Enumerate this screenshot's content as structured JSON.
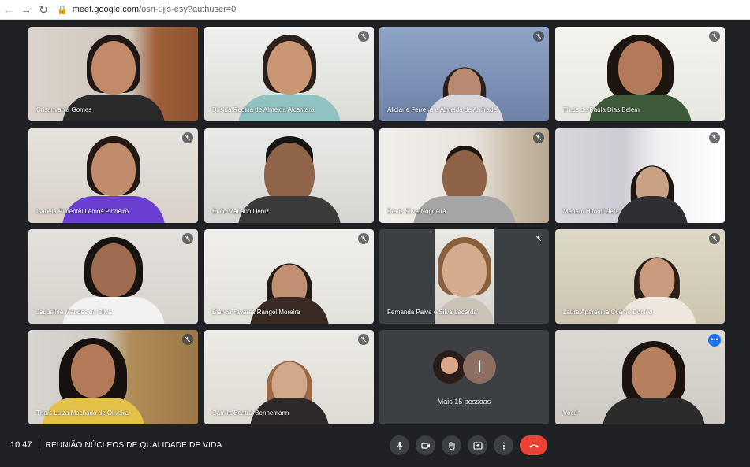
{
  "browser": {
    "url_host": "meet.google.com",
    "url_path": "/osn-ujjs-esy?authuser=0"
  },
  "participants": [
    {
      "name": "Crisanvania Gomes",
      "muted": false
    },
    {
      "name": "Brisida Regina de Almeida Alcantara",
      "muted": true
    },
    {
      "name": "Aliciane Ferreira e Almeida de Andrade",
      "muted": true
    },
    {
      "name": "Thaís de Paula Dias Belem",
      "muted": true
    },
    {
      "name": "Isabela Pimentel Lemos Pinheiro",
      "muted": true
    },
    {
      "name": "Erico Mariano Deniz",
      "muted": false
    },
    {
      "name": "Denis Silva Nogueira",
      "muted": true
    },
    {
      "name": "Mariam Hitomi Ueta",
      "muted": true
    },
    {
      "name": "Jaqueline Mendes da Silva",
      "muted": true
    },
    {
      "name": "Bianca Tavares Rangel Moreira",
      "muted": true
    },
    {
      "name": "Fernanda Paiva e Silva Lacerda",
      "muted": true
    },
    {
      "name": "Laura Aparecida Coelho Dorileo",
      "muted": true
    },
    {
      "name": "Thaís Luiza Machado de Oliveira",
      "muted": true
    },
    {
      "name": "Camila Beatriz Bennemann",
      "muted": true
    }
  ],
  "others": {
    "label": "Mais 15 pessoas",
    "avatar_letter": "I"
  },
  "self_tile": {
    "name": "Você"
  },
  "meeting": {
    "time": "10:47",
    "title": "REUNIÃO NÚCLEOS DE QUALIDADE DE VIDA"
  },
  "colors": {
    "background": "#202124",
    "tile": "#3c4043",
    "end_call": "#ea4335",
    "self_border": "#8ab4f8",
    "accent": "#1a73e8"
  }
}
